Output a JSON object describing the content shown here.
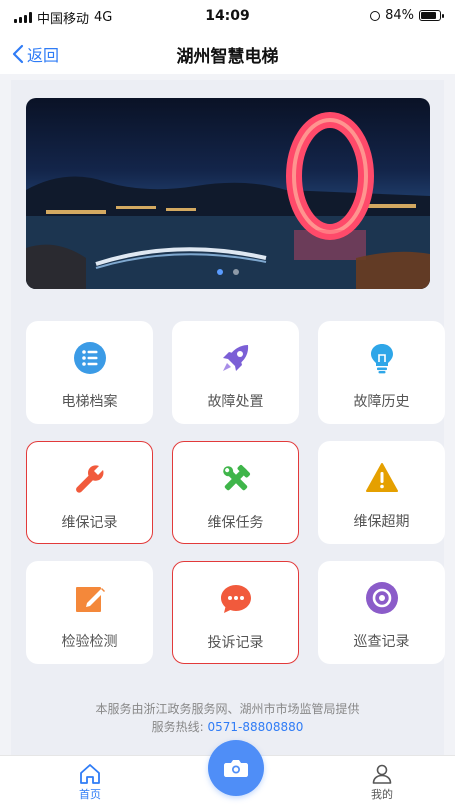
{
  "status_bar": {
    "carrier": "中国移动",
    "network": "4G",
    "time": "14:09",
    "battery": "84%"
  },
  "nav": {
    "back_label": "返回",
    "title": "湖州智慧电梯"
  },
  "banner": {
    "slides_count": 2,
    "active_index": 0
  },
  "menu": [
    {
      "label": "电梯档案",
      "icon": "list-icon",
      "color": "#3b9be6",
      "highlighted": false
    },
    {
      "label": "故障处置",
      "icon": "rocket-icon",
      "color": "#7b5fd6",
      "highlighted": false
    },
    {
      "label": "故障历史",
      "icon": "lightbulb-icon",
      "color": "#2ea6e8",
      "highlighted": false
    },
    {
      "label": "维保记录",
      "icon": "wrench-icon",
      "color": "#f15a3c",
      "highlighted": true
    },
    {
      "label": "维保任务",
      "icon": "tools-icon",
      "color": "#3fb54a",
      "highlighted": true
    },
    {
      "label": "维保超期",
      "icon": "warning-icon",
      "color": "#e5a000",
      "highlighted": false
    },
    {
      "label": "检验检测",
      "icon": "edit-icon",
      "color": "#f4883a",
      "highlighted": false
    },
    {
      "label": "投诉记录",
      "icon": "chat-icon",
      "color": "#f15a3c",
      "highlighted": true
    },
    {
      "label": "巡查记录",
      "icon": "target-icon",
      "color": "#8b5cc9",
      "highlighted": false
    }
  ],
  "footer": {
    "provider_text": "本服务由浙江政务服务网、湖州市市场监管局提供",
    "hotline_label": "服务热线: ",
    "hotline_number": "0571-88808880"
  },
  "tabbar": {
    "home_label": "首页",
    "mine_label": "我的"
  },
  "colors": {
    "accent": "#2f7cf6",
    "highlight_border": "#e23a3a"
  }
}
